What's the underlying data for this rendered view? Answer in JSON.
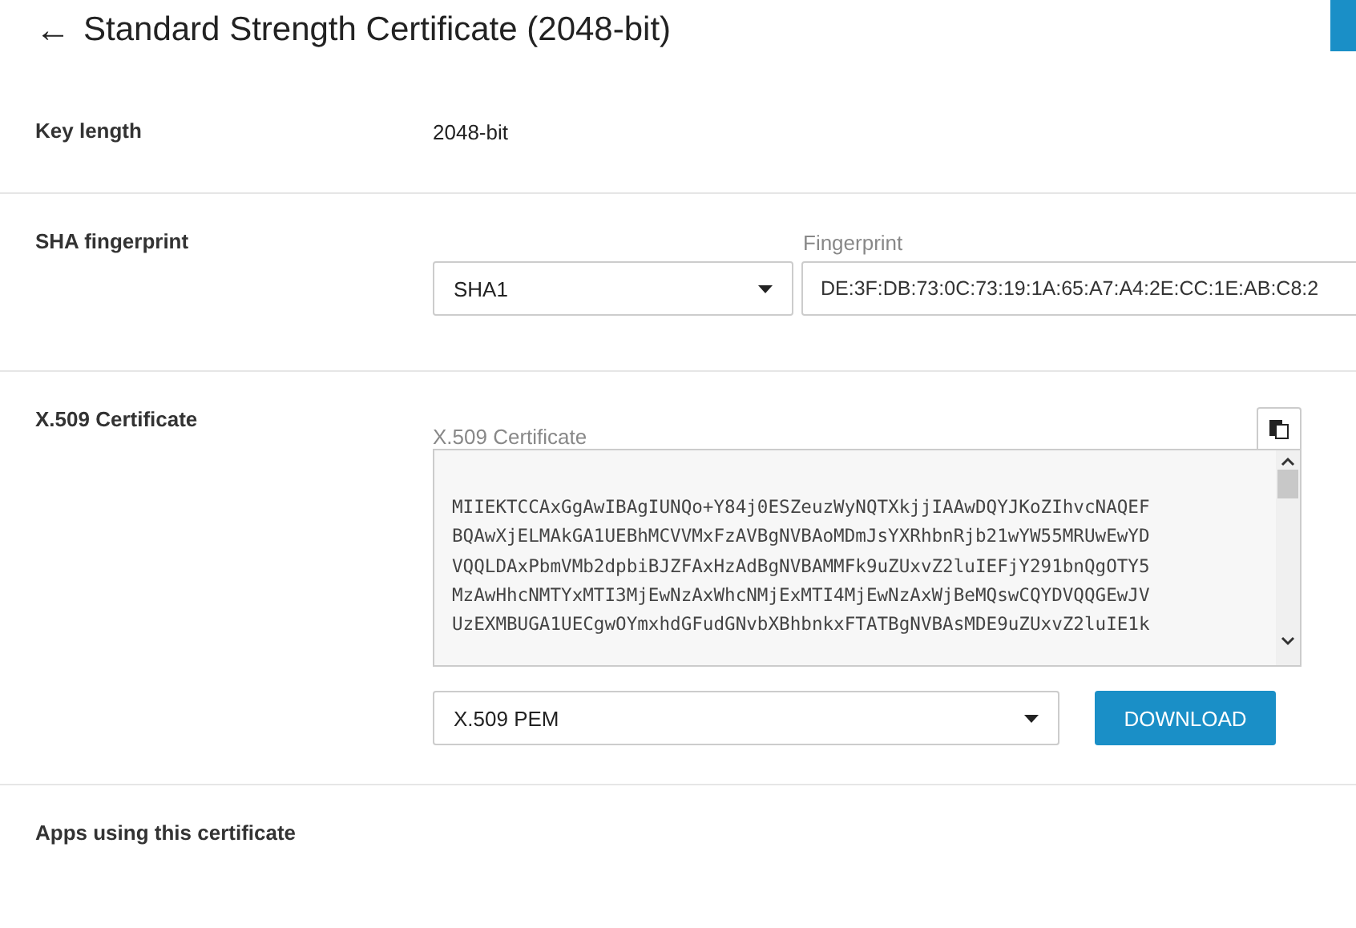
{
  "header": {
    "back_icon": "←",
    "title": "Standard Strength Certificate (2048-bit)"
  },
  "key_length": {
    "label": "Key length",
    "value": "2048-bit"
  },
  "sha": {
    "label": "SHA fingerprint",
    "algorithm": "SHA1",
    "field_label": "Fingerprint",
    "value": "DE:3F:DB:73:0C:73:19:1A:65:A7:A4:2E:CC:1E:AB:C8:2"
  },
  "certificate": {
    "label": "X.509 Certificate",
    "field_label": "X.509 Certificate",
    "lines": [
      "MIIEKTCCAxGgAwIBAgIUNQo+Y84j0ESZeuzWyNQTXkjjIAAwDQYJKoZIhvcNAQEF",
      "BQAwXjELMAkGA1UEBhMCVVMxFzAVBgNVBAoMDmJsYXRhbnRjb21wYW55MRUwEwYD",
      "VQQLDAxPbmVMb2dpbiBJZFAxHzAdBgNVBAMMFk9uZUxvZ2luIEFjY291bnQgOTY5",
      "MzAwHhcNMTYxMTI3MjEwNzAxWhcNMjExMTI4MjEwNzAxWjBeMQswCQYDVQQGEwJV",
      "UzEXMBUGA1UECgwOYmxhdGFudGNvbXBhbnkxFTATBgNVBAsMDE9uZUxvZ2luIE1k"
    ],
    "format": "X.509 PEM",
    "download": "DOWNLOAD"
  },
  "apps": {
    "label": "Apps using this certificate"
  }
}
